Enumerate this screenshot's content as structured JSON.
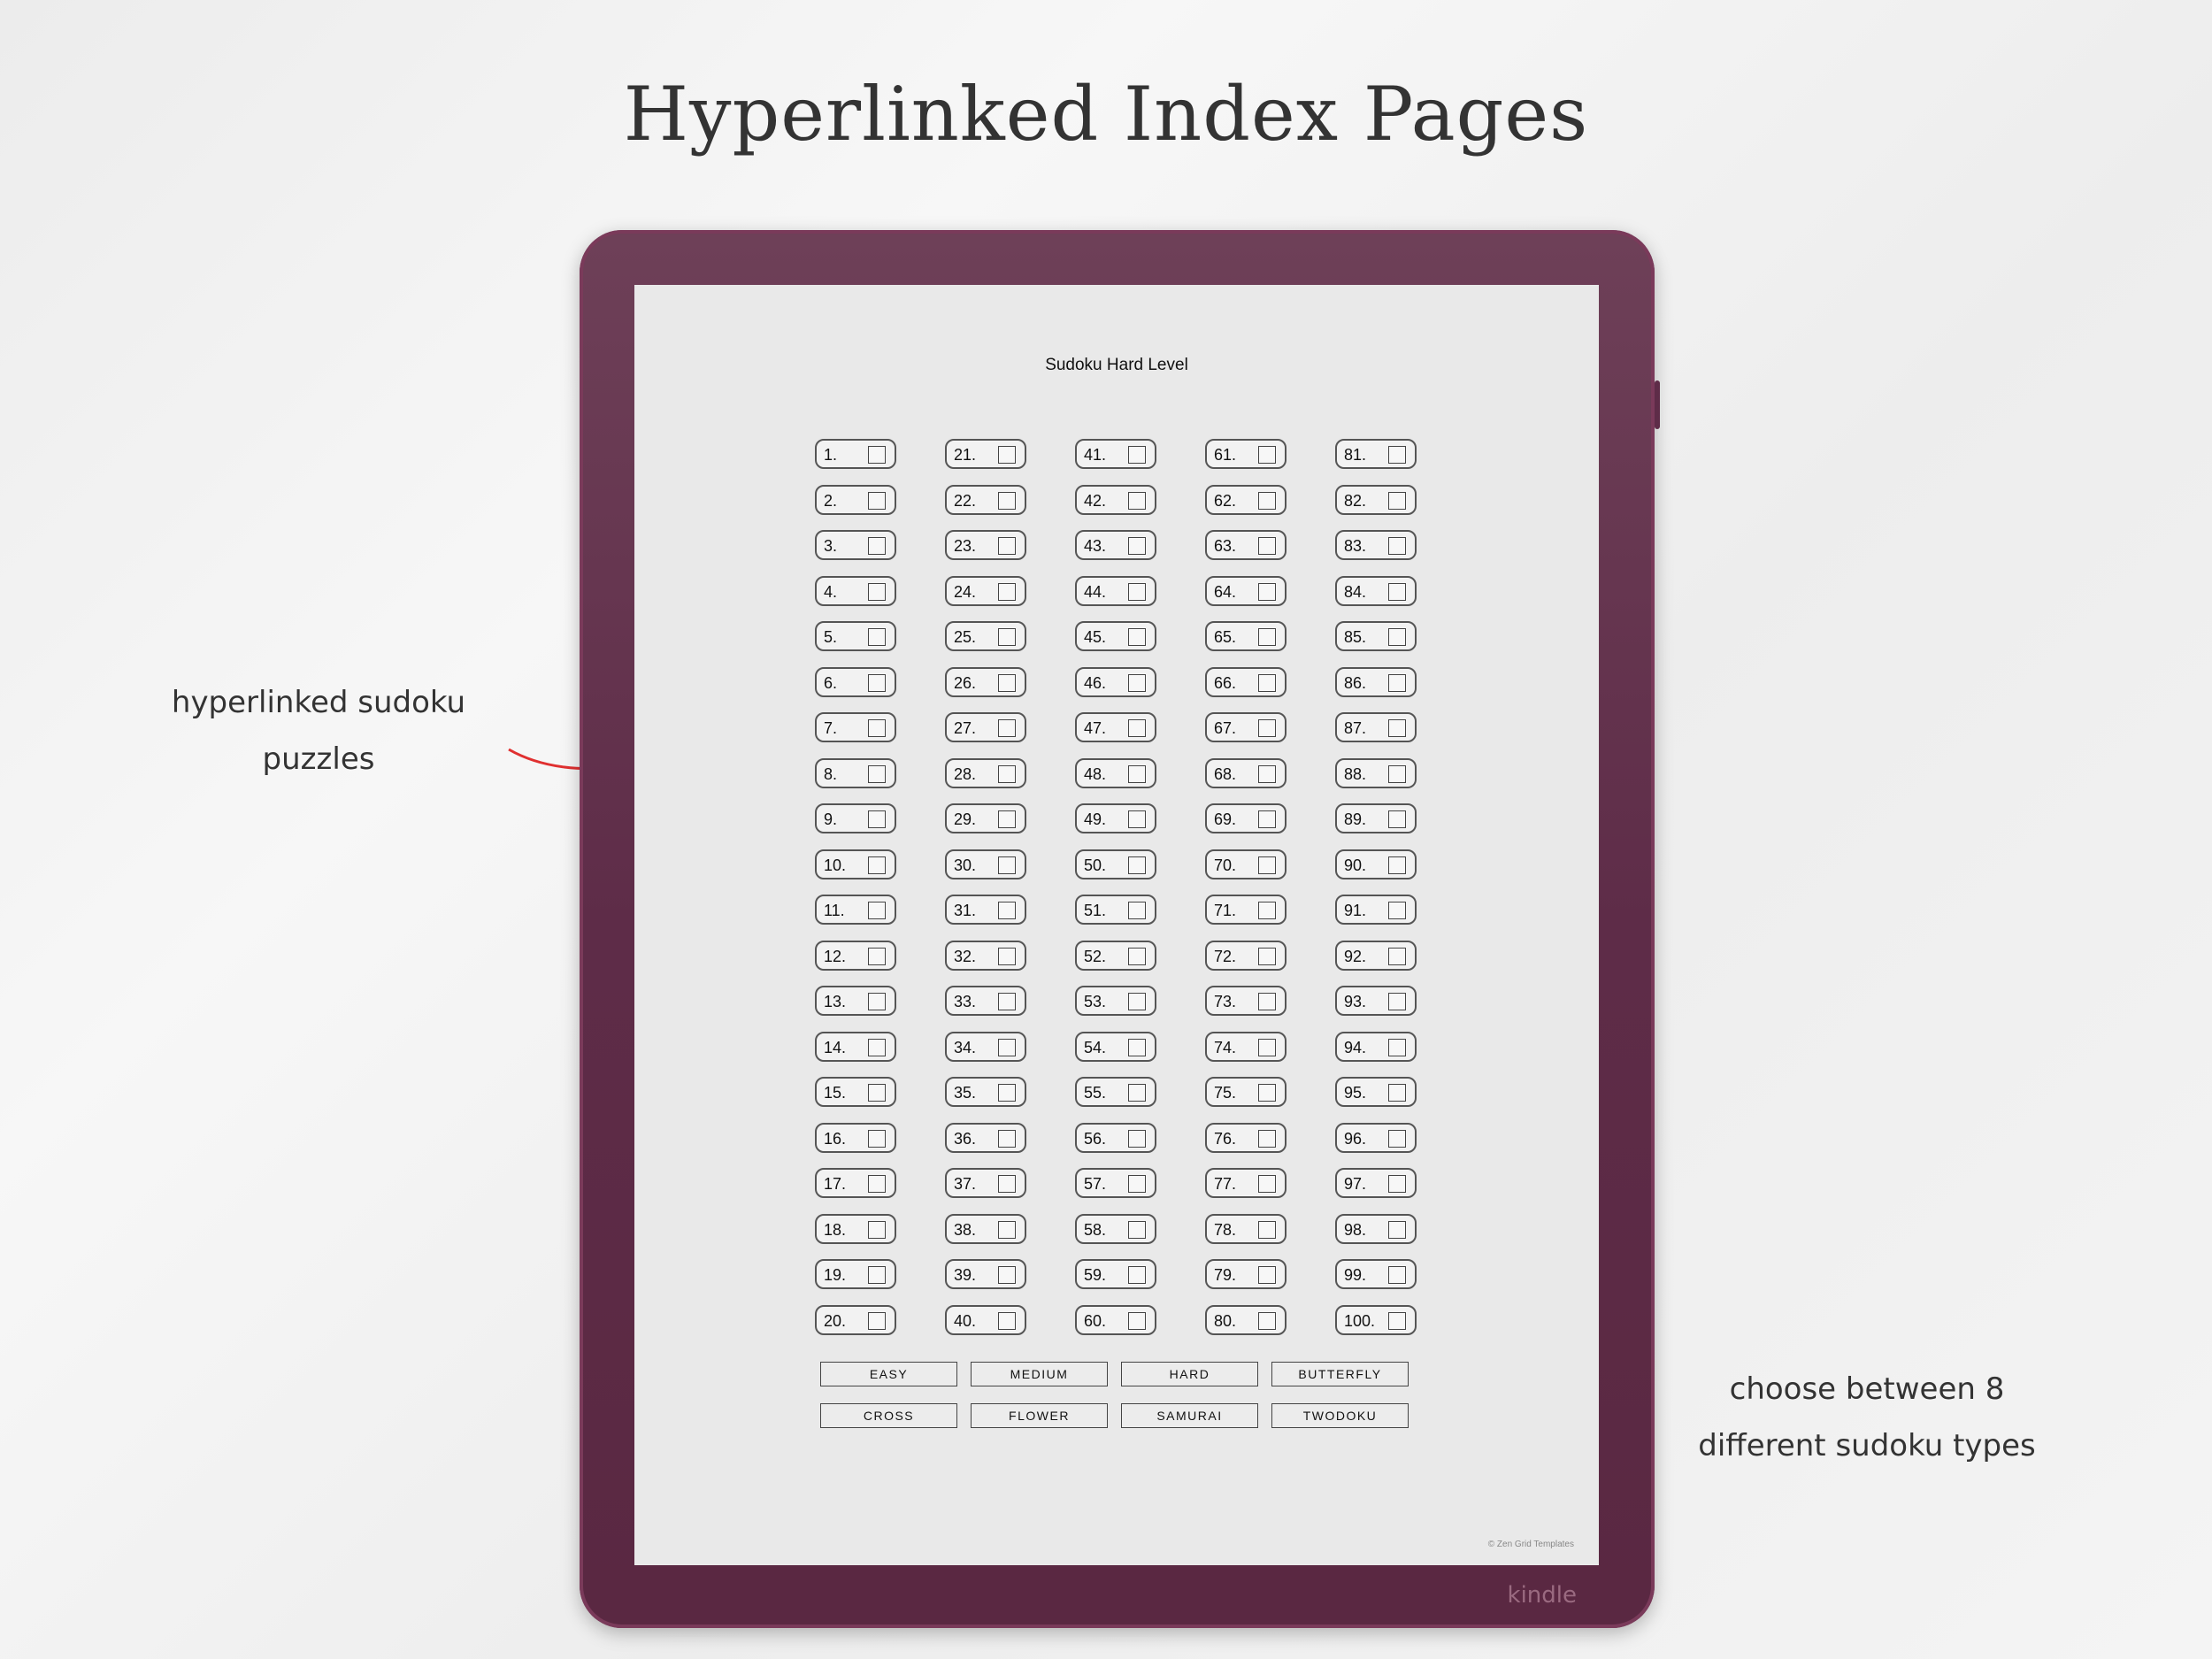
{
  "headline": "Hyperlinked Index Pages",
  "notes": {
    "left": [
      "hyperlinked sudoku",
      "puzzles"
    ],
    "right": [
      "choose between 8",
      "different sudoku types"
    ]
  },
  "colors": {
    "device": "#5e2c48",
    "arrow": "#e03030",
    "screen": "#e9e9e9"
  },
  "device": {
    "brand": "kindle"
  },
  "screen": {
    "title": "Sudoku Hard Level",
    "puzzles": [
      "1.",
      "2.",
      "3.",
      "4.",
      "5.",
      "6.",
      "7.",
      "8.",
      "9.",
      "10.",
      "11.",
      "12.",
      "13.",
      "14.",
      "15.",
      "16.",
      "17.",
      "18.",
      "19.",
      "20.",
      "21.",
      "22.",
      "23.",
      "24.",
      "25.",
      "26.",
      "27.",
      "28.",
      "29.",
      "30.",
      "31.",
      "32.",
      "33.",
      "34.",
      "35.",
      "36.",
      "37.",
      "38.",
      "39.",
      "40.",
      "41.",
      "42.",
      "43.",
      "44.",
      "45.",
      "46.",
      "47.",
      "48.",
      "49.",
      "50.",
      "51.",
      "52.",
      "53.",
      "54.",
      "55.",
      "56.",
      "57.",
      "58.",
      "59.",
      "60.",
      "61.",
      "62.",
      "63.",
      "64.",
      "65.",
      "66.",
      "67.",
      "68.",
      "69.",
      "70.",
      "71.",
      "72.",
      "73.",
      "74.",
      "75.",
      "76.",
      "77.",
      "78.",
      "79.",
      "80.",
      "81.",
      "82.",
      "83.",
      "84.",
      "85.",
      "86.",
      "87.",
      "88.",
      "89.",
      "90.",
      "91.",
      "92.",
      "93.",
      "94.",
      "95.",
      "96.",
      "97.",
      "98.",
      "99.",
      "100."
    ],
    "types": [
      "EASY",
      "MEDIUM",
      "HARD",
      "BUTTERFLY",
      "CROSS",
      "FLOWER",
      "SAMURAI",
      "TWODOKU"
    ],
    "credit": "© Zen Grid Templates"
  }
}
